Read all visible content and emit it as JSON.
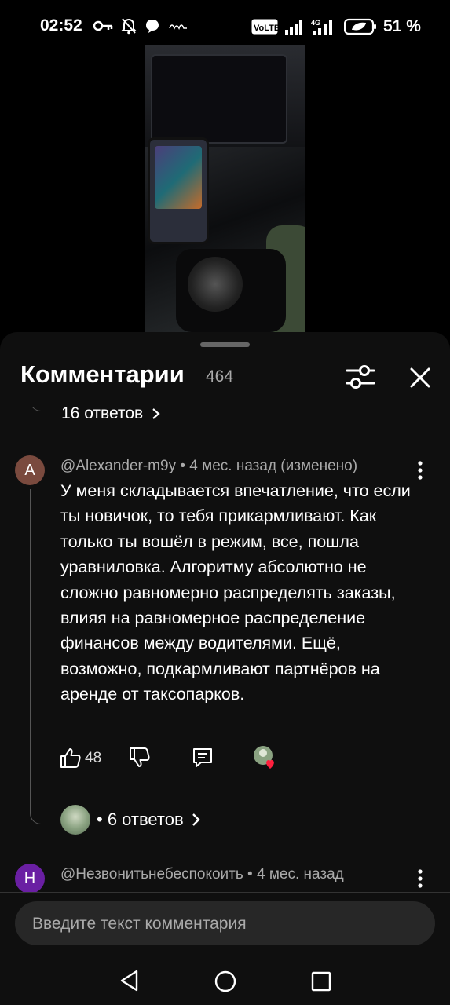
{
  "status_bar": {
    "time": "02:52",
    "left_icons": [
      "key-icon",
      "bell-off-icon",
      "chat-bubble-icon",
      "carrier-text-icon"
    ],
    "right_icons": [
      "volte-icon",
      "signal-icon",
      "4g-signal-icon",
      "battery-icon"
    ],
    "volte_label": "VoLTE",
    "network_label": "4G",
    "battery": "51 %"
  },
  "comments_panel": {
    "title": "Комментарии",
    "count": "464",
    "prev_thread_replies": "16 ответов",
    "comments": [
      {
        "avatar_letter": "A",
        "avatar_color": "#7a4a3e",
        "author": "@Alexander-m9y",
        "meta": " • 4 мес. назад (изменено)",
        "text": "У меня складывается впечатление, что если ты новичок, то тебя прикармливают. Как только ты вошёл в режим, все, пошла уравниловка. Алгоритму абсолютно не сложно равномерно распределять заказы, влияя на равномерное распределение финансов между водителями. Ещё, возможно, подкармливают партнёров на аренде от таксопарков.",
        "likes": "48",
        "replies_label": "• 6 ответов"
      },
      {
        "avatar_letter": "Н",
        "avatar_color": "#6a1fa3",
        "author": "@Незвонитьнебеспокоить",
        "meta": " • 4 мес. назад"
      }
    ],
    "composer_placeholder": "Введите текст комментария"
  },
  "colors": {
    "background": "#000000",
    "sheet": "#0f0f0f",
    "creator_heart": "#ff1f3d"
  }
}
